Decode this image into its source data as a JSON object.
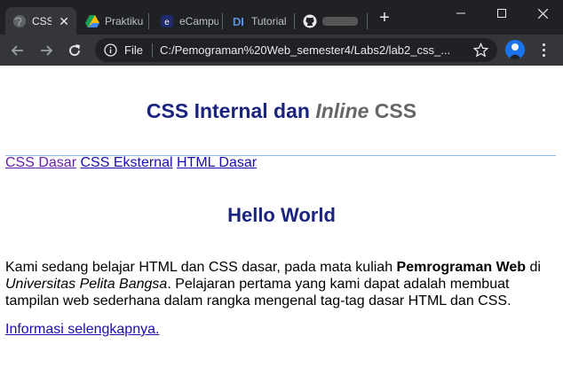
{
  "tabs": [
    {
      "label": "CSS",
      "favicon": "globe-icon",
      "active": true
    },
    {
      "label": "Praktiku",
      "favicon": "google-drive-icon"
    },
    {
      "label": "eCampu",
      "favicon": "ecampus-icon"
    },
    {
      "label": "Tutorial",
      "favicon": "dicoding-icon"
    },
    {
      "label": "",
      "favicon": "github-icon"
    }
  ],
  "toolbar": {
    "scheme_label": "File",
    "url": "C:/Pemograman%20Web_semester4/Labs2/lab2_css_..."
  },
  "page": {
    "title_main": "CSS Internal dan ",
    "title_italic": "Inline",
    "title_end": " CSS",
    "nav": [
      "CSS Dasar",
      "CSS Eksternal",
      "HTML Dasar"
    ],
    "heading": "Hello World",
    "para_1": "Kami sedang belajar HTML dan CSS dasar, pada mata kuliah ",
    "para_bold": "Pemrograman Web",
    "para_2": " di ",
    "para_italic": "Universitas Pelita Bangsa",
    "para_3": ". Pelajaran pertama yang kami dapat adalah membuat tampilan web sederhana dalam rangka mengenal tag-tag dasar HTML dan CSS.",
    "more_link": "Informasi selengkapnya."
  },
  "colors": {
    "heading": "#1a237e",
    "link": "#1a0dab",
    "visited_link": "#681da8",
    "chrome_dark": "#202124",
    "chrome_toolbar": "#35363a"
  }
}
